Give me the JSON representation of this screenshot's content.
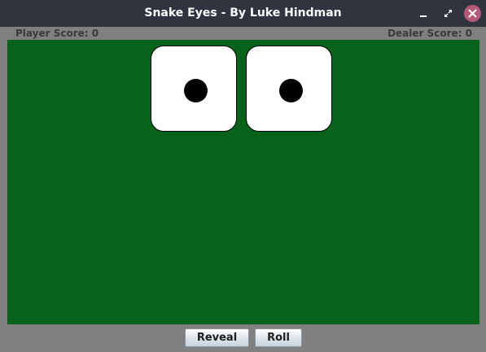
{
  "window": {
    "title": "Snake Eyes - By Luke Hindman",
    "controls": {
      "minimize_icon": "minimize-icon",
      "maximize_icon": "maximize-icon",
      "close_icon": "close-icon"
    }
  },
  "scores": {
    "player": "Player Score: 0",
    "dealer": "Dealer Score: 0"
  },
  "dice": [
    {
      "value": 1
    },
    {
      "value": 1
    }
  ],
  "buttons": {
    "reveal": "Reveal",
    "roll": "Roll"
  },
  "colors": {
    "table": "#07631a",
    "titlebar": "#2f343f",
    "close_button": "#b5597a",
    "background": "#808080"
  }
}
